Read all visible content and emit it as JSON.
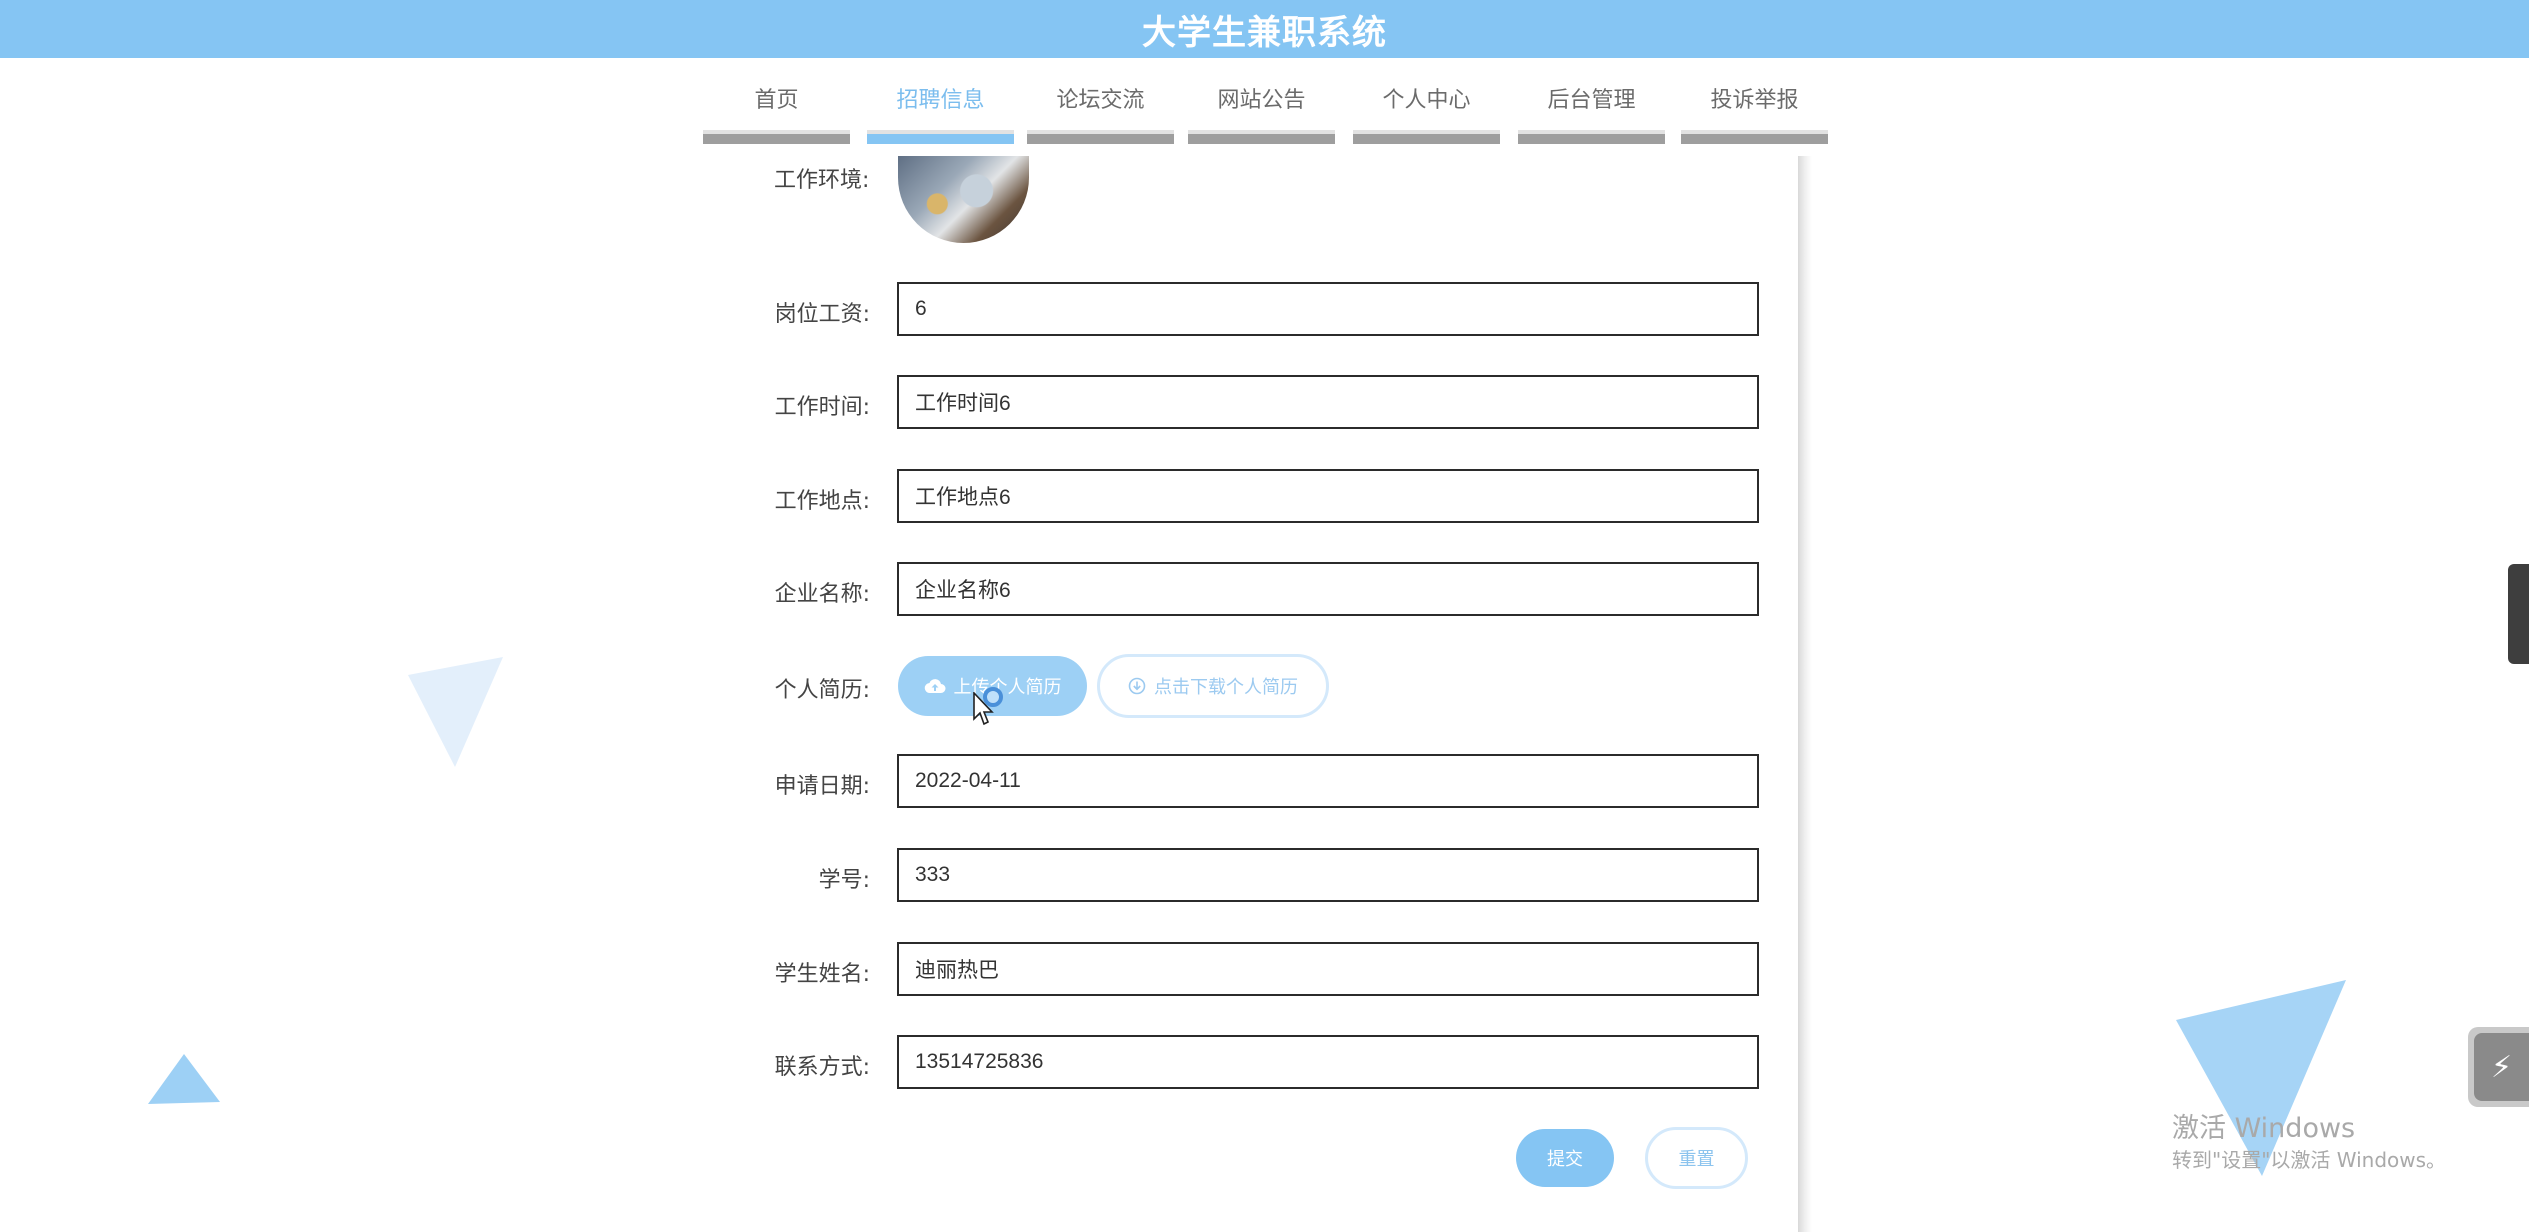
{
  "header": {
    "title": "大学生兼职系统"
  },
  "nav": {
    "items": [
      {
        "label": "首页",
        "active": false
      },
      {
        "label": "招聘信息",
        "active": true
      },
      {
        "label": "论坛交流",
        "active": false
      },
      {
        "label": "网站公告",
        "active": false
      },
      {
        "label": "个人中心",
        "active": false
      },
      {
        "label": "后台管理",
        "active": false
      },
      {
        "label": "投诉举报",
        "active": false
      }
    ]
  },
  "form": {
    "work_env_label": "工作环境:",
    "fields": [
      {
        "label": "岗位工资:",
        "value": "6"
      },
      {
        "label": "工作时间:",
        "value": "工作时间6"
      },
      {
        "label": "工作地点:",
        "value": "工作地点6"
      },
      {
        "label": "企业名称:",
        "value": "企业名称6"
      },
      {
        "label": "申请日期:",
        "value": "2022-04-11"
      },
      {
        "label": "学号:",
        "value": "333"
      },
      {
        "label": "学生姓名:",
        "value": "迪丽热巴"
      },
      {
        "label": "联系方式:",
        "value": "13514725836"
      }
    ],
    "resume": {
      "label": "个人简历:",
      "upload_label": "上传个人简历",
      "download_label": "点击下载个人简历"
    },
    "submit_label": "提交",
    "reset_label": "重置"
  },
  "watermark": {
    "line1": "激活 Windows",
    "line2": "转到\"设置\"以激活 Windows。"
  },
  "colors": {
    "accent": "#85c5f3",
    "nav_inactive_bar": "#9e9e9e",
    "deco_light": "#e3effb"
  }
}
